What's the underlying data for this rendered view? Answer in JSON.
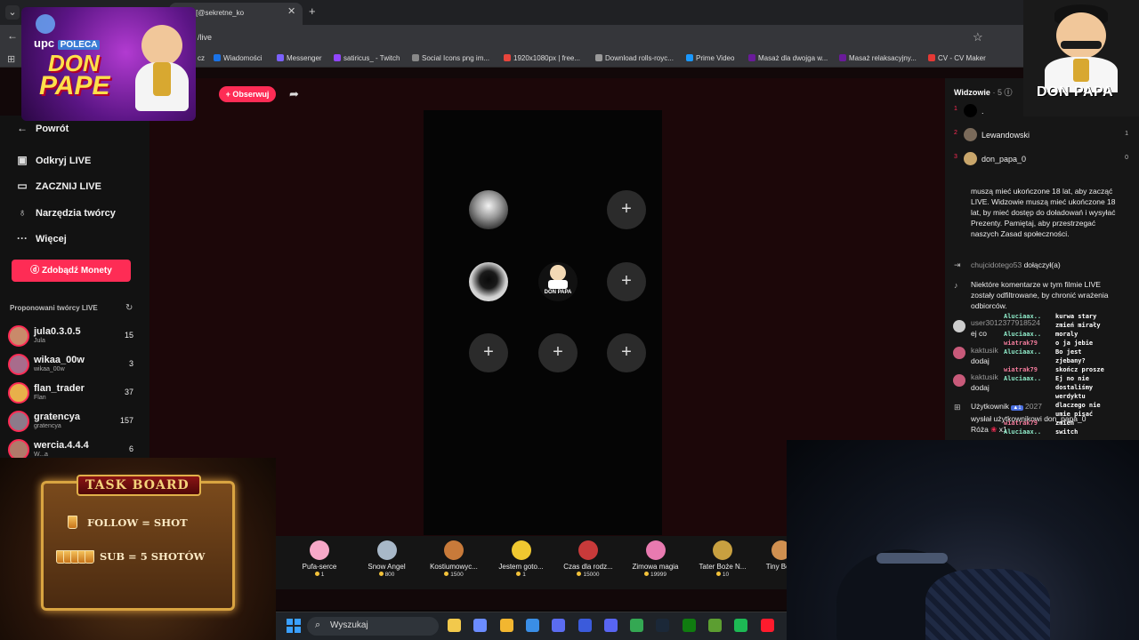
{
  "browser": {
    "tab_title": "🔔😍 [@sekretne_ko",
    "url": "/live",
    "bookmarks": [
      {
        "label": "cz",
        "color": "#555"
      },
      {
        "label": "Wiadomości",
        "color": "#1a73e8"
      },
      {
        "label": "Messenger",
        "color": "#7b61ff"
      },
      {
        "label": "satiricus_ - Twitch",
        "color": "#9146ff"
      },
      {
        "label": "Social Icons png im...",
        "color": "#888"
      },
      {
        "label": "1920x1080px | free...",
        "color": "#e8453c"
      },
      {
        "label": "Download rolls-royc...",
        "color": "#999"
      },
      {
        "label": "Prime Video",
        "color": "#1a98ff"
      },
      {
        "label": "Masaż dla dwojga w...",
        "color": "#6a1b9a"
      },
      {
        "label": "Masaż relaksacyjny...",
        "color": "#6a1b9a"
      },
      {
        "label": "CV - CV Maker",
        "color": "#e53935"
      }
    ]
  },
  "header": {
    "follow_label": "+ Obserwuj"
  },
  "sidebar": {
    "back_label": "Powrót",
    "items": [
      {
        "label": "Odkryj LIVE",
        "icon": "live-icon"
      },
      {
        "label": "ZACZNIJ LIVE",
        "icon": "camera-icon"
      },
      {
        "label": "Narzędzia twórcy",
        "icon": "lightbulb-icon"
      },
      {
        "label": "Więcej",
        "icon": "more-icon"
      }
    ],
    "coins_button": "Zdobądź Monety",
    "suggested_title": "Proponowani twórcy LIVE",
    "creators": [
      {
        "name": "jula0.3.0.5",
        "sub": "Jula",
        "count": "15",
        "color": "#c98a6a"
      },
      {
        "name": "wikaa_00w",
        "sub": "wikaa_00w",
        "count": "3",
        "color": "#a86c8c"
      },
      {
        "name": "flan_trader",
        "sub": "Flan",
        "count": "37",
        "color": "#e8b04a"
      },
      {
        "name": "gratencya",
        "sub": "gratencya",
        "count": "157",
        "color": "#8c7a8a"
      },
      {
        "name": "wercia.4.4.4",
        "sub": "W...a",
        "count": "6",
        "color": "#b07a6a"
      }
    ]
  },
  "guests": {
    "guest_badge": "DON PAPA"
  },
  "viewers": {
    "title": "Widzowie",
    "count": "5",
    "list": [
      {
        "rank": "1",
        "name": ".",
        "score": "",
        "color": "#000000"
      },
      {
        "rank": "2",
        "name": "Lewandowski",
        "score": "1",
        "color": "#7a6a5a"
      },
      {
        "rank": "3",
        "name": "don_papa_0",
        "score": "0",
        "color": "#c9a66b"
      }
    ]
  },
  "chat": {
    "system_notice": "muszą mieć ukończone 18 lat, aby zacząć LIVE. Widzowie muszą mieć ukończone 18 lat, by mieć dostęp do doładowań i wysyłać Prezenty. Pamiętaj, aby przestrzegać naszych Zasad społeczności.",
    "join_user": "chujcidotego53",
    "join_text": "dołączył(a)",
    "filter_notice": "Niektóre komentarze w tym filmie LIVE zostały odfiltrowane, by chronić wrażenia odbiorców.",
    "messages": [
      {
        "user": "user3012377918524",
        "text": "ej co"
      },
      {
        "user": "kaktusik",
        "text": "dodaj"
      },
      {
        "user": "kaktusik",
        "text": "dodaj"
      }
    ],
    "gift_user": "Użytkownik",
    "gift_text": "wysłał użytkownikowi don_papa_0",
    "gift_item": "Róża",
    "gift_qty": "x1",
    "gift_level": "2027"
  },
  "overlay_chat": [
    {
      "name": "Aluciaax..",
      "msg": "kurwa stary",
      "cls": "ov-n"
    },
    {
      "name": "",
      "msg": "zmień mirały",
      "cls": "ov-n"
    },
    {
      "name": "Aluciaax..",
      "msg": "moraly",
      "cls": "ov-n"
    },
    {
      "name": "wiatrak79",
      "msg": "o ja jebie",
      "cls": "ov-n2"
    },
    {
      "name": "Aluciaax..",
      "msg": "Bo jest",
      "cls": "ov-n"
    },
    {
      "name": "",
      "msg": "zjebany?",
      "cls": "ov-n"
    },
    {
      "name": "wiatrak79",
      "msg": "skończ prosze",
      "cls": "ov-n2"
    },
    {
      "name": "Aluciaax..",
      "msg": "Ej no nie",
      "cls": "ov-n"
    },
    {
      "name": "",
      "msg": "dostaliśmy",
      "cls": "ov-n"
    },
    {
      "name": "",
      "msg": "werdyktu",
      "cls": "ov-n"
    },
    {
      "name": "",
      "msg": "dlaczego nie",
      "cls": "ov-n"
    },
    {
      "name": "",
      "msg": "umie pisać",
      "cls": "ov-n"
    },
    {
      "name": "wiatrak79",
      "msg": "zmień",
      "cls": "ov-n2"
    },
    {
      "name": "Aluciaax..",
      "msg": "switch",
      "cls": "ov-n"
    }
  ],
  "logos": {
    "left_upc": "upc",
    "left_poleca": "POLECA",
    "left_don": "DON",
    "left_pape": "PAPE",
    "right_text": "DON PAPA"
  },
  "taskboard": {
    "title": "TASK BOARD",
    "line1": "FOLLOW = SHOT",
    "line2": "SUB = 5 SHOTÓW"
  },
  "gifts": [
    {
      "name": "Pufa-serce",
      "price": "1",
      "color": "#f7a8c8"
    },
    {
      "name": "Snow Angel",
      "price": "800",
      "color": "#a8b8c8"
    },
    {
      "name": "Kostiumowyc...",
      "price": "1500",
      "color": "#c87a3a"
    },
    {
      "name": "Jestem goto...",
      "price": "1",
      "color": "#f0c830"
    },
    {
      "name": "Czas dla rodz...",
      "price": "15000",
      "color": "#c83a3a"
    },
    {
      "name": "Zimowa magia",
      "price": "19999",
      "color": "#e87ab0"
    },
    {
      "name": "Tater Boże N...",
      "price": "10",
      "color": "#c8a040"
    },
    {
      "name": "Tiny Bo...",
      "price": "",
      "color": "#d09050"
    }
  ],
  "taskbar": {
    "search_label": "Wyszukaj",
    "apps": [
      {
        "name": "file-explorer-icon",
        "color": "#f2c94c"
      },
      {
        "name": "copilot-icon",
        "color": "#6b8cff"
      },
      {
        "name": "folder-icon",
        "color": "#f2b630"
      },
      {
        "name": "store-icon",
        "color": "#3a8ee6"
      },
      {
        "name": "vpn-icon",
        "color": "#5b6cf0"
      },
      {
        "name": "l-app-icon",
        "color": "#3b5bdb"
      },
      {
        "name": "discord-icon",
        "color": "#5865f2"
      },
      {
        "name": "chrome-icon",
        "color": "#34a853"
      },
      {
        "name": "steam-icon",
        "color": "#1b2838"
      },
      {
        "name": "xbox-icon",
        "color": "#107c10"
      },
      {
        "name": "minecraft-icon",
        "color": "#5c9e31"
      },
      {
        "name": "spotify-icon",
        "color": "#1db954"
      },
      {
        "name": "opera-icon",
        "color": "#ff1b2d"
      }
    ]
  }
}
